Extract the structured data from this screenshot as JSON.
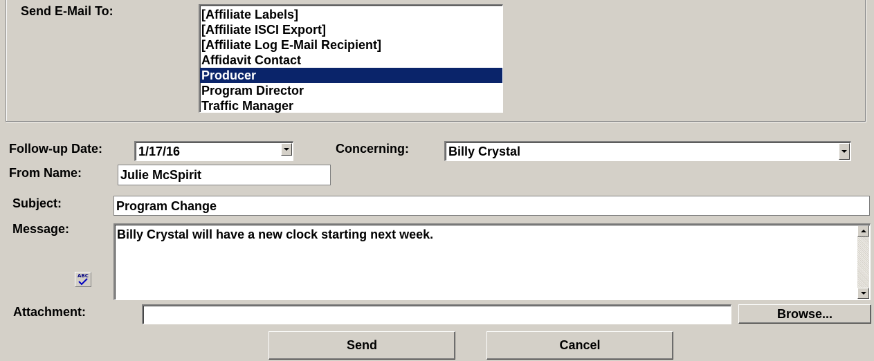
{
  "labels": {
    "send_to": "Send E-Mail To:",
    "followup_date": "Follow-up Date:",
    "concerning": "Concerning:",
    "from_name": "From Name:",
    "subject": "Subject:",
    "message": "Message:",
    "attachment": "Attachment:"
  },
  "recipients": {
    "items": [
      "[Affiliate Labels]",
      "[Affiliate ISCI Export]",
      "[Affiliate Log E-Mail Recipient]",
      "Affidavit Contact",
      "Producer",
      "Program Director",
      "Traffic Manager"
    ],
    "selected": "Producer"
  },
  "fields": {
    "followup_date": "1/17/16",
    "concerning": "Billy Crystal",
    "from_name": "Julie McSpirit",
    "subject": "Program Change",
    "message": "Billy Crystal will have a new clock starting next week.",
    "attachment": ""
  },
  "buttons": {
    "browse": "Browse...",
    "send": "Send",
    "cancel": "Cancel"
  },
  "icons": {
    "spellcheck_text": "ABC"
  },
  "colors": {
    "window_bg": "#d4d0c8",
    "selection_bg": "#0a246a",
    "selection_fg": "#ffffff"
  }
}
